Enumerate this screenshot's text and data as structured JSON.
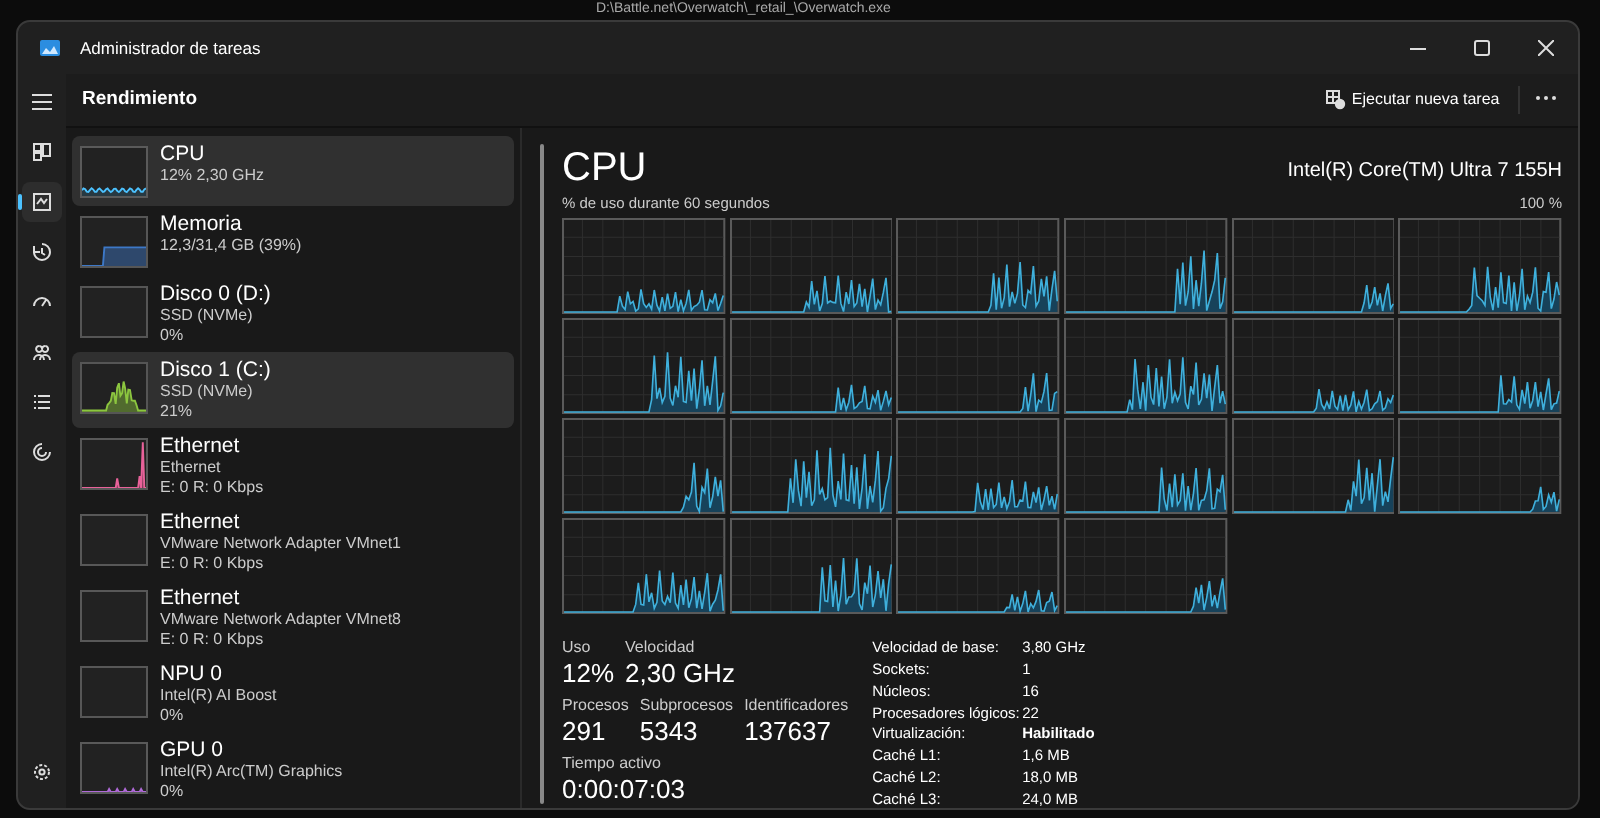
{
  "backdrop_text": "D:\\Battle.net\\Overwatch\\_retail_\\Overwatch.exe",
  "window": {
    "title": "Administrador de tareas"
  },
  "nav": [
    {
      "kind": "processes",
      "selected": false
    },
    {
      "kind": "performance",
      "selected": true
    },
    {
      "kind": "history",
      "selected": false
    },
    {
      "kind": "startup",
      "selected": false
    },
    {
      "kind": "users",
      "selected": false
    },
    {
      "kind": "details",
      "selected": false
    },
    {
      "kind": "services",
      "selected": false
    }
  ],
  "page_title": "Rendimiento",
  "toolbar": {
    "run_task": "Ejecutar nueva tarea"
  },
  "devices": [
    {
      "kind": "cpu",
      "name": "CPU",
      "lines": [
        "12% 2,30 GHz"
      ],
      "color": "#4cc2ff",
      "selected": true
    },
    {
      "kind": "memory",
      "name": "Memoria",
      "lines": [
        "12,3/31,4 GB (39%)"
      ],
      "color": "#3d78c7",
      "selected": false
    },
    {
      "kind": "disk",
      "name": "Disco 0 (D:)",
      "lines": [
        "SSD (NVMe)",
        "0%"
      ],
      "selected": false
    },
    {
      "kind": "disk",
      "name": "Disco 1 (C:)",
      "lines": [
        "SSD (NVMe)",
        "21%"
      ],
      "color": "#8cc63f",
      "selected": true
    },
    {
      "kind": "network",
      "name": "Ethernet",
      "lines": [
        "Ethernet",
        "E: 0 R: 0 Kbps"
      ],
      "color": "#e8629a",
      "selected": false
    },
    {
      "kind": "network",
      "name": "Ethernet",
      "lines": [
        "VMware Network Adapter VMnet1",
        "E: 0 R: 0 Kbps"
      ],
      "selected": false
    },
    {
      "kind": "network",
      "name": "Ethernet",
      "lines": [
        "VMware Network Adapter VMnet8",
        "E: 0 R: 0 Kbps"
      ],
      "selected": false
    },
    {
      "kind": "npu",
      "name": "NPU 0",
      "lines": [
        "Intel(R) AI Boost",
        "0%"
      ],
      "selected": false
    },
    {
      "kind": "gpu",
      "name": "GPU 0",
      "lines": [
        "Intel(R) Arc(TM) Graphics",
        "0%"
      ],
      "color": "#b06ad8",
      "selected": false
    }
  ],
  "detail": {
    "title": "CPU",
    "model": "Intel(R) Core(TM) Ultra 7 155H",
    "graph_caption": "% de uso durante 60 segundos",
    "graph_max": "100 %",
    "stat_rows": [
      [
        {
          "label": "Uso",
          "value": "12%"
        },
        {
          "label": "Velocidad",
          "value": "2,30 GHz"
        }
      ],
      [
        {
          "label": "Procesos",
          "value": "291"
        },
        {
          "label": "Subprocesos",
          "value": "5343"
        },
        {
          "label": "Identificadores",
          "value": "137637"
        }
      ],
      [
        {
          "label": "Tiempo activo",
          "value": "0:00:07:03"
        }
      ]
    ],
    "specs": [
      {
        "label": "Velocidad de base:",
        "value": "3,80 GHz",
        "emphasis": false
      },
      {
        "label": "Sockets:",
        "value": "1",
        "emphasis": false
      },
      {
        "label": "Núcleos:",
        "value": "16",
        "emphasis": false
      },
      {
        "label": "Procesadores lógicos:",
        "value": "22",
        "emphasis": false
      },
      {
        "label": "Virtualización:",
        "value": "Habilitado",
        "emphasis": true
      },
      {
        "label": "Caché L1:",
        "value": "1,6 MB",
        "emphasis": false
      },
      {
        "label": "Caché L2:",
        "value": "18,0 MB",
        "emphasis": false
      },
      {
        "label": "Caché L3:",
        "value": "24,0 MB",
        "emphasis": false
      }
    ]
  }
}
